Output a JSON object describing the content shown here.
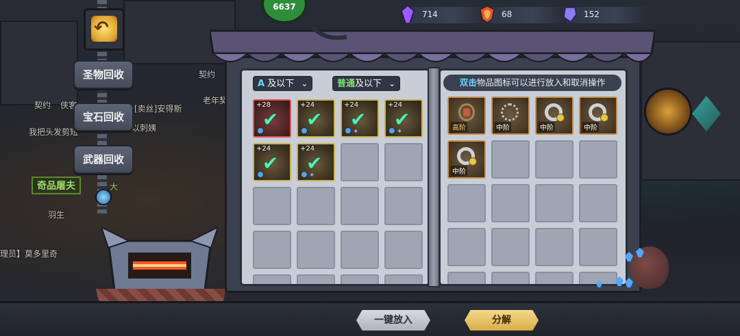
{
  "resources": [
    {
      "name": "purple-crystal",
      "value": "714",
      "color": "#9b5cff"
    },
    {
      "name": "red-shield",
      "value": "68",
      "color": "#e0563a"
    },
    {
      "name": "blue-gem",
      "value": "152",
      "color": "#8c7cf0"
    }
  ],
  "sidebar": {
    "back_icon": "back-arrow-icon",
    "buttons": [
      {
        "label": "圣物回收"
      },
      {
        "label": "宝石回收"
      },
      {
        "label": "武器回收"
      }
    ]
  },
  "background_labels": {
    "npc1": "契约",
    "npc2": "侠客",
    "npc3": "[卖丝]安得斯",
    "npc4": "我把头发剪短",
    "npc5": "奇品屠夫",
    "npc6": "羽生",
    "npc7": "理员】莫多里奇",
    "npc8": "老年契",
    "npc9": "契约",
    "npc10": "大",
    "npc11": "卖以刺姨"
  },
  "gauge_value": "6637",
  "left_page": {
    "filter_rarity": {
      "prefix_icon": "A",
      "label": "及以下"
    },
    "filter_quality": {
      "highlight": "普通",
      "label": "及以下"
    },
    "items": [
      {
        "level": "+28",
        "selected": true,
        "red": true
      },
      {
        "level": "+24",
        "selected": true,
        "red": false
      },
      {
        "level": "+24",
        "selected": true,
        "red": false
      },
      {
        "level": "+24",
        "selected": true,
        "red": false
      },
      {
        "level": "+24",
        "selected": true,
        "red": false
      },
      {
        "level": "+24",
        "selected": true,
        "red": false
      }
    ]
  },
  "right_page": {
    "hint_highlight": "双击",
    "hint_text": "物品图标可以进行放入和取消操作",
    "items": [
      {
        "type": "amulet",
        "tier": "高阶"
      },
      {
        "type": "chain",
        "tier": "中阶"
      },
      {
        "type": "ring",
        "tier": "中阶"
      },
      {
        "type": "ring",
        "tier": "中阶"
      },
      {
        "type": "ring",
        "tier": "中阶"
      }
    ]
  },
  "actions": {
    "put_all": "一键放入",
    "decompose": "分解"
  }
}
